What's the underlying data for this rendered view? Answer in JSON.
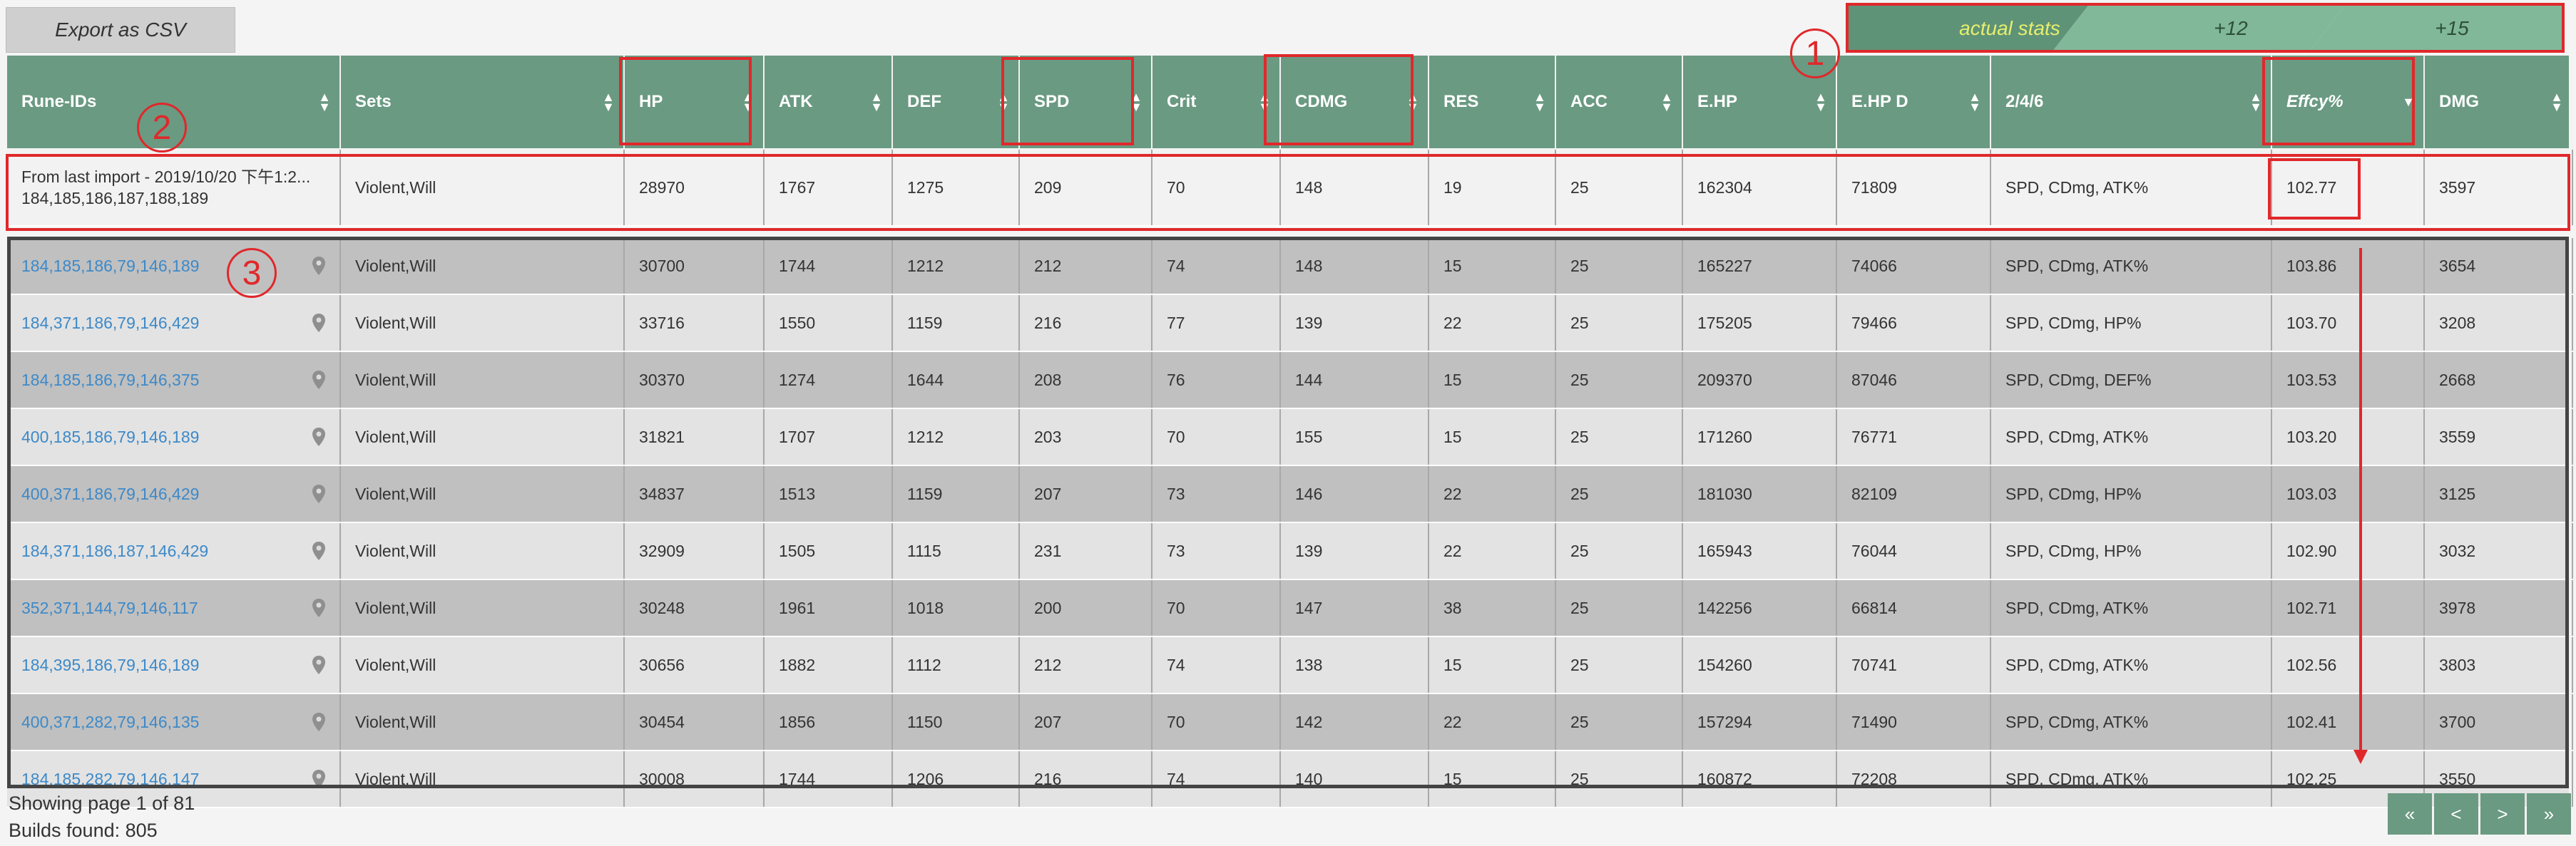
{
  "toolbar": {
    "export_label": "Export as CSV"
  },
  "stats_tabs": {
    "actual": "actual stats",
    "plus12": "+12",
    "plus15": "+15"
  },
  "columns": [
    "Rune-IDs",
    "Sets",
    "HP",
    "ATK",
    "DEF",
    "SPD",
    "Crit",
    "CDMG",
    "RES",
    "ACC",
    "E.HP",
    "E.HP D",
    "2/4/6",
    "Effcy%",
    "DMG"
  ],
  "import_row": {
    "title": "From last import - 2019/10/20 下午1:2...",
    "ids": "184,185,186,187,188,189",
    "cells": [
      "Violent,Will",
      "28970",
      "1767",
      "1275",
      "209",
      "70",
      "148",
      "19",
      "25",
      "162304",
      "71809",
      "SPD, CDmg, ATK%",
      "102.77",
      "3597"
    ]
  },
  "rows": [
    [
      "184,185,186,79,146,189",
      "Violent,Will",
      "30700",
      "1744",
      "1212",
      "212",
      "74",
      "148",
      "15",
      "25",
      "165227",
      "74066",
      "SPD, CDmg, ATK%",
      "103.86",
      "3654"
    ],
    [
      "184,371,186,79,146,429",
      "Violent,Will",
      "33716",
      "1550",
      "1159",
      "216",
      "77",
      "139",
      "22",
      "25",
      "175205",
      "79466",
      "SPD, CDmg, HP%",
      "103.70",
      "3208"
    ],
    [
      "184,185,186,79,146,375",
      "Violent,Will",
      "30370",
      "1274",
      "1644",
      "208",
      "76",
      "144",
      "15",
      "25",
      "209370",
      "87046",
      "SPD, CDmg, DEF%",
      "103.53",
      "2668"
    ],
    [
      "400,185,186,79,146,189",
      "Violent,Will",
      "31821",
      "1707",
      "1212",
      "203",
      "70",
      "155",
      "15",
      "25",
      "171260",
      "76771",
      "SPD, CDmg, ATK%",
      "103.20",
      "3559"
    ],
    [
      "400,371,186,79,146,429",
      "Violent,Will",
      "34837",
      "1513",
      "1159",
      "207",
      "73",
      "146",
      "22",
      "25",
      "181030",
      "82109",
      "SPD, CDmg, HP%",
      "103.03",
      "3125"
    ],
    [
      "184,371,186,187,146,429",
      "Violent,Will",
      "32909",
      "1505",
      "1115",
      "231",
      "73",
      "139",
      "22",
      "25",
      "165943",
      "76044",
      "SPD, CDmg, HP%",
      "102.90",
      "3032"
    ],
    [
      "352,371,144,79,146,117",
      "Violent,Will",
      "30248",
      "1961",
      "1018",
      "200",
      "70",
      "147",
      "38",
      "25",
      "142256",
      "66814",
      "SPD, CDmg, ATK%",
      "102.71",
      "3978"
    ],
    [
      "184,395,186,79,146,189",
      "Violent,Will",
      "30656",
      "1882",
      "1112",
      "212",
      "74",
      "138",
      "15",
      "25",
      "154260",
      "70741",
      "SPD, CDmg, ATK%",
      "102.56",
      "3803"
    ],
    [
      "400,371,282,79,146,135",
      "Violent,Will",
      "30454",
      "1856",
      "1150",
      "207",
      "70",
      "142",
      "22",
      "25",
      "157294",
      "71490",
      "SPD, CDmg, ATK%",
      "102.41",
      "3700"
    ],
    [
      "184,185,282,79,146,147",
      "Violent,Will",
      "30008",
      "1744",
      "1206",
      "216",
      "74",
      "140",
      "15",
      "25",
      "160872",
      "72208",
      "SPD, CDmg, ATK%",
      "102.25",
      "3550"
    ]
  ],
  "footer": {
    "page_text": "Showing page 1 of 81",
    "builds_text": "Builds found: 805"
  },
  "pager": {
    "first": "«",
    "prev": "<",
    "next": ">",
    "last": "»"
  },
  "annotations": {
    "one": "1",
    "two": "2",
    "three": "3"
  }
}
